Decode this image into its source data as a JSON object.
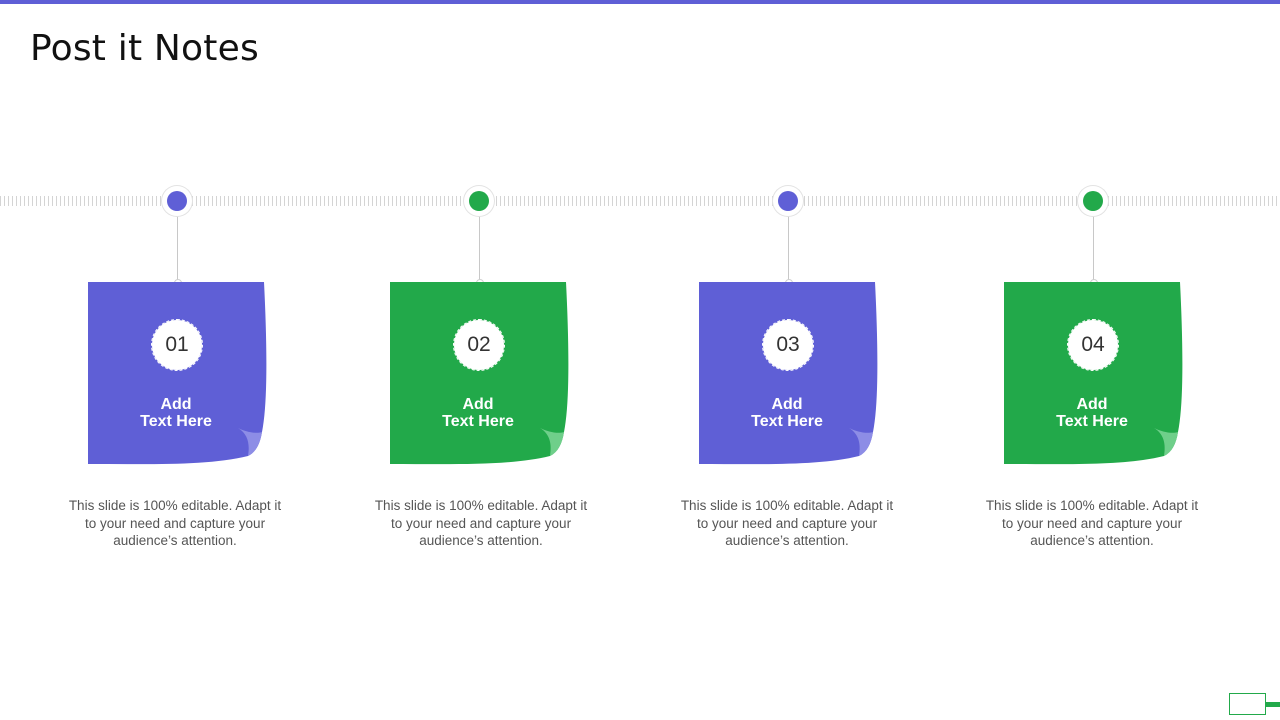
{
  "slide": {
    "title": "Post it Notes"
  },
  "colors": {
    "purple": "#5f5fd6",
    "green": "#22a94a",
    "accent_bar": "#5f5fd6"
  },
  "notes": [
    {
      "number": "01",
      "label_line1": "Add",
      "label_line2": "Text Here",
      "color": "#5f5fd6",
      "description": "This slide is 100% editable. Adapt it to your need and capture your audience’s attention."
    },
    {
      "number": "02",
      "label_line1": "Add",
      "label_line2": "Text Here",
      "color": "#22a94a",
      "description": "This slide is 100% editable. Adapt it to your need and capture your audience’s attention."
    },
    {
      "number": "03",
      "label_line1": "Add",
      "label_line2": "Text Here",
      "color": "#5f5fd6",
      "description": "This slide is 100% editable. Adapt it to your need and capture your audience’s attention."
    },
    {
      "number": "04",
      "label_line1": "Add",
      "label_line2": "Text Here",
      "color": "#22a94a",
      "description": "This slide is 100% editable. Adapt it to your need and capture your audience’s attention."
    }
  ]
}
